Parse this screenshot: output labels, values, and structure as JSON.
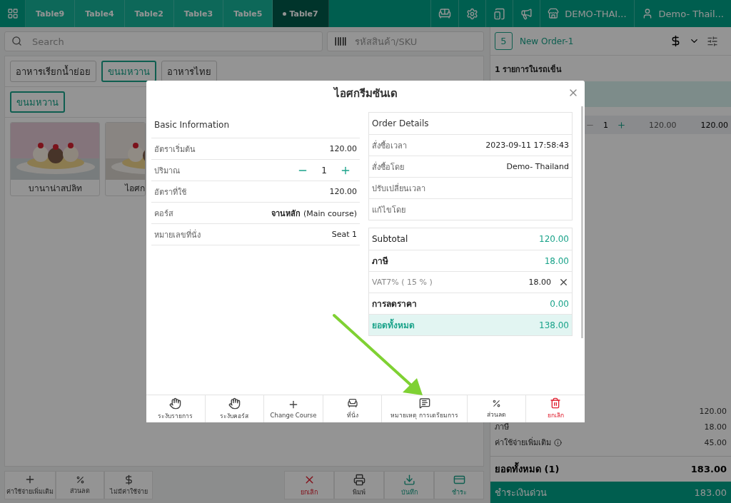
{
  "topbar": {
    "tabs": [
      {
        "label": "Table9",
        "selected": false
      },
      {
        "label": "Table4",
        "selected": false
      },
      {
        "label": "Table2",
        "selected": false
      },
      {
        "label": "Table3",
        "selected": false
      },
      {
        "label": "Table5",
        "selected": false
      },
      {
        "label": "Table7",
        "selected": true
      }
    ],
    "store": "DEMO-THAI...",
    "user": "Demo- Thail..."
  },
  "search": {
    "placeholder": "Search"
  },
  "sku": {
    "placeholder": "รหัสสินค้า/SKU"
  },
  "categories": [
    {
      "label": "อาหารเรียกน้ำย่อย",
      "selected": false
    },
    {
      "label": "ขนมหวาน",
      "selected": true
    },
    {
      "label": "อาหารไทย",
      "selected": false
    }
  ],
  "subcategories": [
    {
      "label": "ขนมหวาน",
      "selected": true
    }
  ],
  "products": [
    {
      "name": "บานาน่าสปลิท",
      "kind": "picture"
    },
    {
      "name": "ไอศก",
      "kind": "picture"
    }
  ],
  "left_actions": [
    {
      "label": "ค่าใช้จ่ายเพิ่มเติม",
      "kind": "plus"
    },
    {
      "label": "ส่วนลด",
      "kind": "percent"
    },
    {
      "label": "ไม่มีค่าใช้จ่าย",
      "kind": "nodollar"
    }
  ],
  "right_actions": [
    {
      "label": "ยกเลิก",
      "kind": "cancel"
    },
    {
      "label": "พิมพ์",
      "kind": "print"
    },
    {
      "label": "บันทึก",
      "kind": "save"
    },
    {
      "label": "ชำระ",
      "kind": "pay"
    }
  ],
  "order": {
    "count": "5",
    "name": "New Order-1",
    "cart_label": "1 รายการในรถเข็น",
    "item": {
      "qty": "1",
      "price": "120.00",
      "total": "120.00"
    },
    "summary": [
      {
        "value": "120.00"
      },
      {
        "label": "ภาษี",
        "value": "18.00"
      },
      {
        "label": "ค่าใช้จ่ายเพิ่มเติม",
        "value": "45.00",
        "info": true
      }
    ],
    "total_label": "ยอดทั้งหมด  (1)",
    "total": "183.00",
    "pay_label": "ชำระเงินด่วน",
    "pay_total": "183.00"
  },
  "modal": {
    "title": "ไอศกรีมซันเด",
    "basic_title": "Basic Information",
    "basic": [
      {
        "label": "อัตราเริ่มต้น",
        "value": "120.00",
        "kind": "text"
      },
      {
        "label": "ปริมาณ",
        "value": "1",
        "kind": "stepper"
      },
      {
        "label": "อัตราที่ใช้",
        "value": "120.00",
        "kind": "text"
      },
      {
        "label": "คอร์ส",
        "value": "**จานหลัก** (Main course)",
        "kind": "text"
      },
      {
        "label": "หมายเลขที่นั่ง",
        "value": "Seat 1",
        "kind": "text"
      }
    ],
    "details_title": "Order Details",
    "details": [
      {
        "label": "สั่งซื้อเวลา",
        "value": "2023-09-11 17:58:43"
      },
      {
        "label": "สั่งซื้อโดย",
        "value": "Demo- Thailand"
      },
      {
        "label": "ปรับเปลี่ยนเวลา"
      },
      {
        "label": "แก้ไขโดย"
      }
    ],
    "totals": [
      {
        "label": "Subtotal",
        "value": "120.00",
        "kind": "plain"
      },
      {
        "label": "ภาษี",
        "value": "18.00",
        "kind": "bold"
      },
      {
        "label": "VAT7% ( 15 % )",
        "value": "18.00",
        "kind": "removable"
      },
      {
        "label": "การลดราคา",
        "value": "0.00",
        "kind": "bold"
      },
      {
        "label": "ยอดทั้งหมด",
        "value": "138.00",
        "kind": "total"
      }
    ],
    "actions": [
      {
        "label": "ระงับรายการ",
        "kind": "hand"
      },
      {
        "label": "ระงับคอร์ส",
        "kind": "hand"
      },
      {
        "label": "Change Course",
        "kind": "plus"
      },
      {
        "label": "ที่นั่ง",
        "kind": "seat"
      },
      {
        "label": "หมายเหตุ การเตรียมการ",
        "kind": "note"
      },
      {
        "label": "ส่วนลด",
        "kind": "percent"
      },
      {
        "label": "ยกเลิก",
        "kind": "delete"
      }
    ]
  }
}
